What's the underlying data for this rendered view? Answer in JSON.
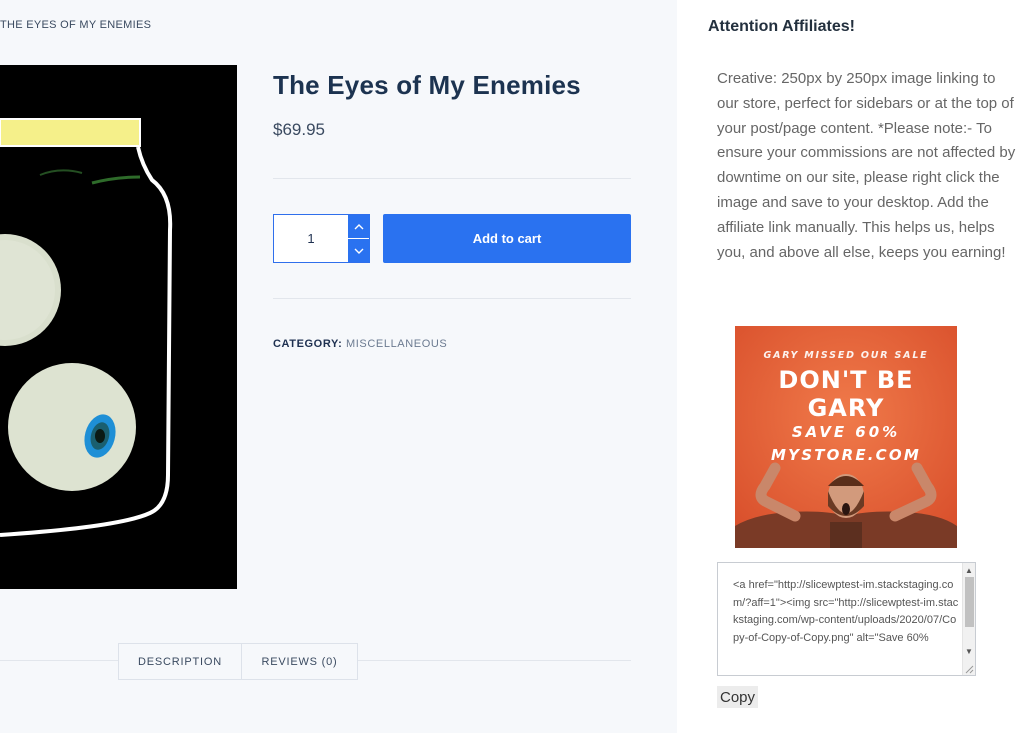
{
  "breadcrumb": "THE EYES OF MY ENEMIES",
  "product": {
    "title": "The Eyes of My Enemies",
    "price": "$69.95",
    "quantity": "1",
    "add_to_cart_label": "Add to cart",
    "category_label": "CATEGORY:",
    "category_value": "MISCELLANEOUS"
  },
  "tabs": {
    "description": "DESCRIPTION",
    "reviews": "REVIEWS (0)"
  },
  "sidebar": {
    "title": "Attention Affiliates!",
    "text": "Creative: 250px by 250px image linking to our store, perfect for sidebars or at the top of your post/page content. *Please note:- To ensure your commissions are not affected by downtime on our site, please right click the image and save to your desktop. Add the affiliate link manually. This helps us, helps you, and above all else, keeps you earning!",
    "banner": {
      "eyebrow": "GARY MISSED OUR SALE",
      "headline_1": "DON'T BE",
      "headline_2": "GARY",
      "save": "SAVE 60%",
      "store": "MYSTORE.COM"
    },
    "code": "<a href=\"http://slicewptest-im.stackstaging.com/?aff=1\"><img src=\"http://slicewptest-im.stackstaging.com/wp-content/uploads/2020/07/Copy-of-Copy-of-Copy.png\" alt=\"Save 60%",
    "copy_label": "Copy"
  },
  "colors": {
    "accent": "#2a72f0",
    "title": "#1c3350",
    "banner_bg": "#e5603a"
  }
}
